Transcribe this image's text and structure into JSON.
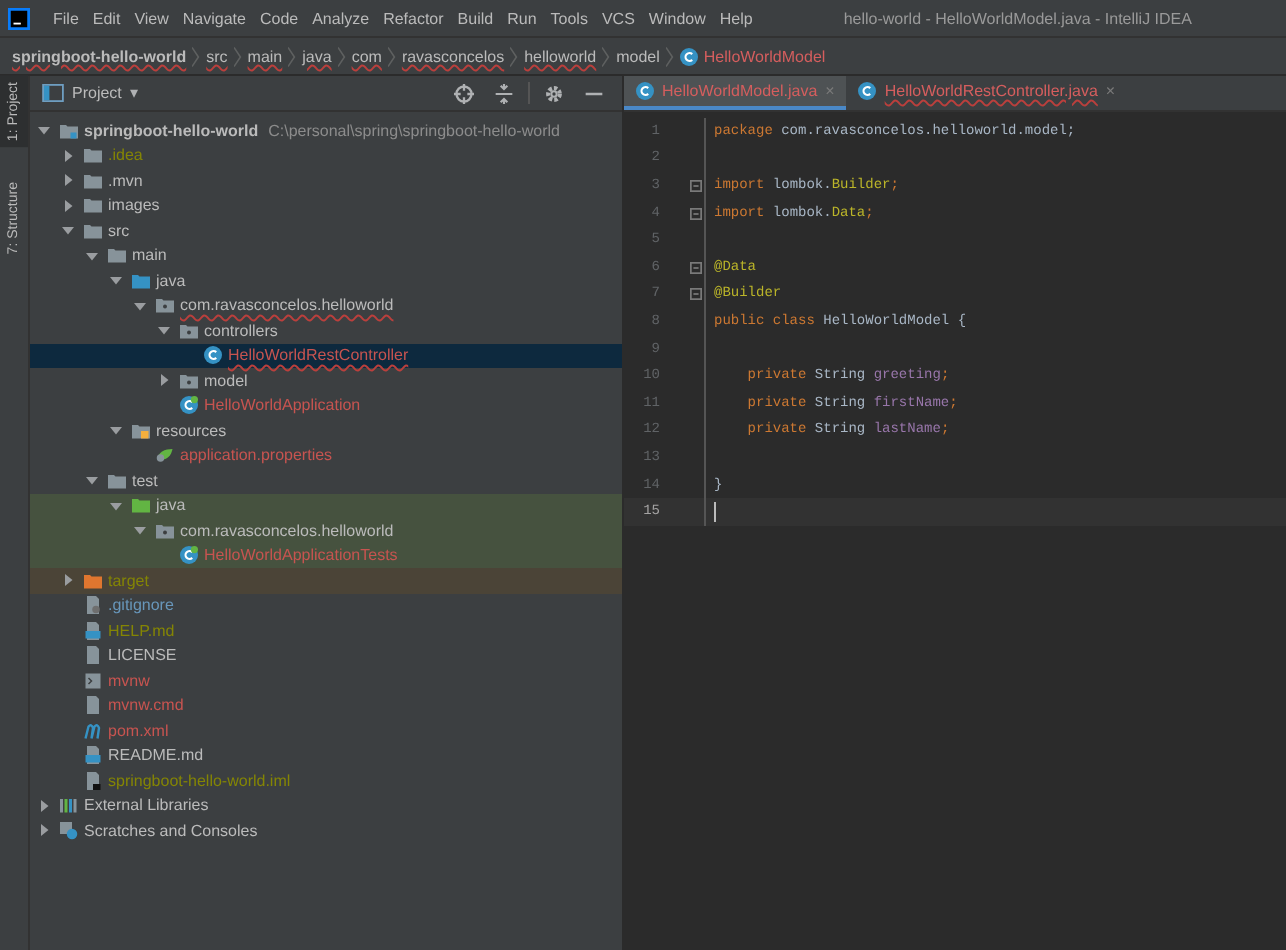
{
  "window": {
    "title": "hello-world - HelloWorldModel.java - IntelliJ IDEA"
  },
  "menu": [
    "File",
    "Edit",
    "View",
    "Navigate",
    "Code",
    "Analyze",
    "Refactor",
    "Build",
    "Run",
    "Tools",
    "VCS",
    "Window",
    "Help"
  ],
  "breadcrumbs": [
    {
      "label": "springboot-hello-world",
      "kind": "project",
      "error": true
    },
    {
      "label": "src",
      "kind": "dir",
      "error": true
    },
    {
      "label": "main",
      "kind": "dir",
      "error": true
    },
    {
      "label": "java",
      "kind": "dir",
      "error": true
    },
    {
      "label": "com",
      "kind": "dir",
      "error": true
    },
    {
      "label": "ravasconcelos",
      "kind": "dir",
      "error": true
    },
    {
      "label": "helloworld",
      "kind": "dir",
      "error": true
    },
    {
      "label": "model",
      "kind": "dir",
      "error": false
    },
    {
      "label": "HelloWorldModel",
      "kind": "class",
      "error": false
    }
  ],
  "side_tabs": [
    {
      "label": "1: Project",
      "selected": true
    },
    {
      "label": "7: Structure",
      "selected": false
    }
  ],
  "project_panel": {
    "title": "Project",
    "caret": "▾"
  },
  "project_tree": [
    {
      "label": "springboot-hello-world",
      "path": "C:\\personal\\spring\\springboot-hello-world",
      "kind": "module",
      "color": "#bbbbbb",
      "selected": false,
      "expanded": true,
      "children": [
        {
          "label": ".idea",
          "kind": "folder",
          "color": "#848504",
          "selected": false,
          "expanded": false
        },
        {
          "label": ".mvn",
          "kind": "folder",
          "color": "#bbbbbb",
          "selected": false,
          "expanded": false
        },
        {
          "label": "images",
          "kind": "folder",
          "color": "#bbbbbb",
          "selected": false,
          "expanded": false
        },
        {
          "label": "src",
          "kind": "folder",
          "color": "#bbbbbb",
          "selected": false,
          "expanded": true,
          "children": [
            {
              "label": "main",
              "kind": "folder",
              "color": "#bbbbbb",
              "selected": false,
              "expanded": true,
              "children": [
                {
                  "label": "java",
                  "kind": "source",
                  "color": "#bbbbbb",
                  "selected": false,
                  "expanded": true,
                  "children": [
                    {
                      "label": "com.ravasconcelos.helloworld",
                      "kind": "package",
                      "color": "#bbbbbb",
                      "error": true,
                      "selected": false,
                      "expanded": true,
                      "children": [
                        {
                          "label": "controllers",
                          "kind": "package",
                          "color": "#bbbbbb",
                          "selected": false,
                          "expanded": true,
                          "children": [
                            {
                              "label": "HelloWorldRestController",
                              "kind": "class",
                              "color": "#c75450",
                              "error": true,
                              "selected": true
                            }
                          ]
                        },
                        {
                          "label": "model",
                          "kind": "package",
                          "color": "#bbbbbb",
                          "selected": false,
                          "expanded": false
                        },
                        {
                          "label": "HelloWorldApplication",
                          "kind": "spring",
                          "color": "#c75450",
                          "selected": false
                        }
                      ]
                    }
                  ]
                },
                {
                  "label": "resources",
                  "kind": "resources",
                  "color": "#bbbbbb",
                  "selected": false,
                  "expanded": true,
                  "children": [
                    {
                      "label": "application.properties",
                      "kind": "properties",
                      "color": "#c75450",
                      "selected": false
                    }
                  ]
                }
              ]
            },
            {
              "label": "test",
              "kind": "folder",
              "color": "#bbbbbb",
              "selected": false,
              "expanded": true,
              "children": [
                {
                  "label": "java",
                  "kind": "test",
                  "color": "#bbbbbb",
                  "test_scope": true,
                  "selected": false,
                  "expanded": true,
                  "children": [
                    {
                      "label": "com.ravasconcelos.helloworld",
                      "kind": "package",
                      "color": "#bbbbbb",
                      "test_scope": true,
                      "selected": false,
                      "expanded": true,
                      "children": [
                        {
                          "label": "HelloWorldApplicationTests",
                          "kind": "spring",
                          "color": "#c75450",
                          "test_scope": true,
                          "selected": false
                        }
                      ]
                    }
                  ]
                }
              ]
            }
          ]
        },
        {
          "label": "target",
          "kind": "excluded",
          "color": "#848504",
          "excluded": true,
          "selected": false,
          "expanded": false
        },
        {
          "label": ".gitignore",
          "kind": "gitignore",
          "color": "#6897bb",
          "selected": false
        },
        {
          "label": "HELP.md",
          "kind": "markdown",
          "color": "#848504",
          "selected": false
        },
        {
          "label": "LICENSE",
          "kind": "file",
          "color": "#bbbbbb",
          "selected": false
        },
        {
          "label": "mvnw",
          "kind": "script",
          "color": "#c75450",
          "selected": false
        },
        {
          "label": "mvnw.cmd",
          "kind": "file",
          "color": "#c75450",
          "selected": false
        },
        {
          "label": "pom.xml",
          "kind": "maven",
          "color": "#c75450",
          "selected": false
        },
        {
          "label": "README.md",
          "kind": "markdown",
          "color": "#bbbbbb",
          "selected": false
        },
        {
          "label": "springboot-hello-world.iml",
          "kind": "iml",
          "color": "#848504",
          "selected": false
        }
      ]
    },
    {
      "label": "External Libraries",
      "kind": "library",
      "color": "#bbbbbb",
      "selected": false,
      "expanded": false
    },
    {
      "label": "Scratches and Consoles",
      "kind": "scratch",
      "color": "#bbbbbb",
      "selected": false,
      "expanded": false
    }
  ],
  "editor_tabs": [
    {
      "label": "HelloWorldModel.java",
      "close": "×",
      "selected": true,
      "error": false
    },
    {
      "label": "HelloWorldRestController.java",
      "close": "×",
      "selected": false,
      "error": true
    }
  ],
  "code_lines": [
    {
      "number": "1",
      "fold": false,
      "current": false,
      "tokens": [
        {
          "text": "package",
          "kind": "keyword"
        },
        {
          "text": " com.ravasconcelos.helloworld.model;",
          "kind": "plain"
        }
      ]
    },
    {
      "number": "2",
      "fold": false,
      "current": false
    },
    {
      "number": "3",
      "fold": true,
      "current": false,
      "tokens": [
        {
          "text": "import",
          "kind": "keyword"
        },
        {
          "text": " lombok.",
          "kind": "plain"
        },
        {
          "text": "Builder",
          "kind": "annotation"
        },
        {
          "text": ";",
          "kind": "keyword"
        }
      ]
    },
    {
      "number": "4",
      "fold": true,
      "current": false,
      "tokens": [
        {
          "text": "import",
          "kind": "keyword"
        },
        {
          "text": " lombok.",
          "kind": "plain"
        },
        {
          "text": "Data",
          "kind": "annotation"
        },
        {
          "text": ";",
          "kind": "keyword"
        }
      ]
    },
    {
      "number": "5",
      "fold": false,
      "current": false
    },
    {
      "number": "6",
      "fold": true,
      "current": false,
      "tokens": [
        {
          "text": "@Data",
          "kind": "annotation"
        }
      ]
    },
    {
      "number": "7",
      "fold": true,
      "current": false,
      "tokens": [
        {
          "text": "@Builder",
          "kind": "annotation"
        }
      ]
    },
    {
      "number": "8",
      "fold": false,
      "current": false,
      "tokens": [
        {
          "text": "public class",
          "kind": "keyword"
        },
        {
          "text": " HelloWorldModel {",
          "kind": "plain"
        }
      ]
    },
    {
      "number": "9",
      "fold": false,
      "current": false
    },
    {
      "number": "10",
      "fold": false,
      "current": false,
      "tokens": [
        {
          "text": "    private",
          "kind": "keyword"
        },
        {
          "text": " String ",
          "kind": "plain"
        },
        {
          "text": "greeting",
          "kind": "field"
        },
        {
          "text": ";",
          "kind": "keyword"
        }
      ]
    },
    {
      "number": "11",
      "fold": false,
      "current": false,
      "tokens": [
        {
          "text": "    private",
          "kind": "keyword"
        },
        {
          "text": " String ",
          "kind": "plain"
        },
        {
          "text": "firstName",
          "kind": "field"
        },
        {
          "text": ";",
          "kind": "keyword"
        }
      ]
    },
    {
      "number": "12",
      "fold": false,
      "current": false,
      "tokens": [
        {
          "text": "    private",
          "kind": "keyword"
        },
        {
          "text": " String ",
          "kind": "plain"
        },
        {
          "text": "lastName",
          "kind": "field"
        },
        {
          "text": ";",
          "kind": "keyword"
        }
      ]
    },
    {
      "number": "13",
      "fold": false,
      "current": false
    },
    {
      "number": "14",
      "fold": false,
      "current": false,
      "tokens": [
        {
          "text": "}",
          "kind": "plain"
        }
      ]
    },
    {
      "number": "15",
      "fold": false,
      "current": true
    }
  ]
}
